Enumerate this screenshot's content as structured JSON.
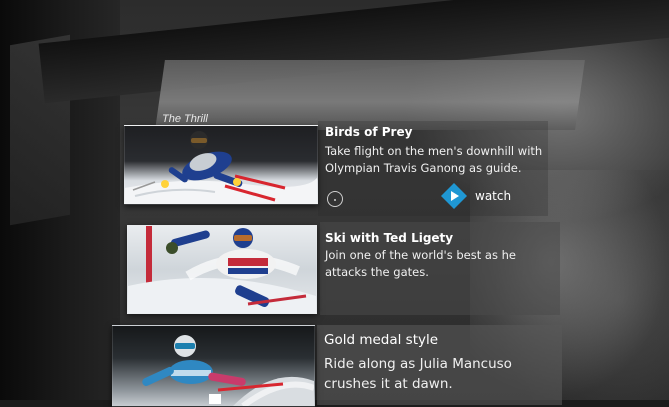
{
  "section": {
    "title": "The Thrill"
  },
  "cards": [
    {
      "title": "Birds of Prey",
      "description": "Take flight on the men's downhill with Olympian Travis Ganong as guide."
    },
    {
      "title": "Ski with Ted Ligety",
      "description": "Join one of the world's best as he attacks the gates."
    },
    {
      "title": "Gold medal style",
      "description": "Ride along as Julia Mancuso crushes it at dawn."
    }
  ],
  "actions": {
    "watch_label": "watch"
  },
  "colors": {
    "watch_accent": "#1f97d3"
  },
  "icons": {
    "watch": "play-diamond-icon",
    "gaze": "gaze-cursor-icon"
  }
}
